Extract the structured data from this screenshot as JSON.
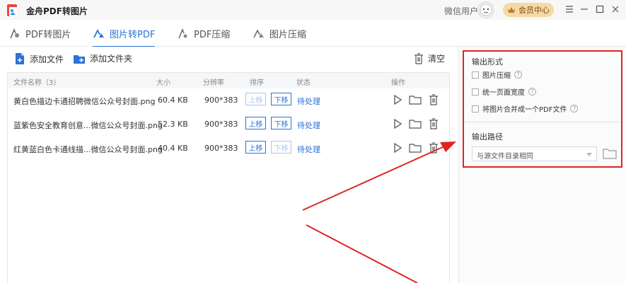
{
  "titlebar": {
    "app_title": "金舟PDF转图片",
    "user_name": "微信用户",
    "vip_label": "会员中心",
    "icons": [
      "app-logo",
      "crown-icon",
      "menu-icon",
      "minimize-icon",
      "maximize-icon",
      "close-icon"
    ]
  },
  "tabs": [
    {
      "label": "PDF转图片",
      "icon": "pdf-to-image-icon",
      "active": false
    },
    {
      "label": "图片转PDF",
      "icon": "image-to-pdf-icon",
      "active": true
    },
    {
      "label": "PDF压缩",
      "icon": "pdf-compress-icon",
      "active": false
    },
    {
      "label": "图片压缩",
      "icon": "image-compress-icon",
      "active": false
    }
  ],
  "toolbar": {
    "add_file": "添加文件",
    "add_folder": "添加文件夹",
    "clear": "清空"
  },
  "table": {
    "headers": {
      "name": "文件名称（3）",
      "size": "大小",
      "resolution": "分辨率",
      "order": "排序",
      "status": "状态",
      "action": "操作"
    },
    "rows": [
      {
        "name": "黄白色描边卡通招聘微信公众号封面.png",
        "size": "60.4 KB",
        "resolution": "900*383",
        "up": "上移",
        "down": "下移",
        "up_enabled": false,
        "down_enabled": true,
        "status": "待处理"
      },
      {
        "name": "蓝紫色安全教育创意...微信公众号封面.png",
        "size": "52.3 KB",
        "resolution": "900*383",
        "up": "上移",
        "down": "下移",
        "up_enabled": true,
        "down_enabled": true,
        "status": "待处理"
      },
      {
        "name": "红黄蓝白色卡通线描...微信公众号封面.png",
        "size": "40.4 KB",
        "resolution": "900*383",
        "up": "上移",
        "down": "下移",
        "up_enabled": true,
        "down_enabled": false,
        "status": "待处理"
      }
    ]
  },
  "settings": {
    "output_form_title": "输出形式",
    "options": [
      {
        "label": "图片压缩",
        "checked": false
      },
      {
        "label": "统一页面宽度",
        "checked": false
      },
      {
        "label": "将图片合并成一个PDF文件",
        "checked": false
      }
    ],
    "help_mark": "?",
    "output_path_title": "输出路径",
    "output_path_value": "与源文件目录相同"
  },
  "colors": {
    "accent": "#2b73d6",
    "annotation": "#e02424",
    "vip_bg": "#f5d9a6"
  }
}
